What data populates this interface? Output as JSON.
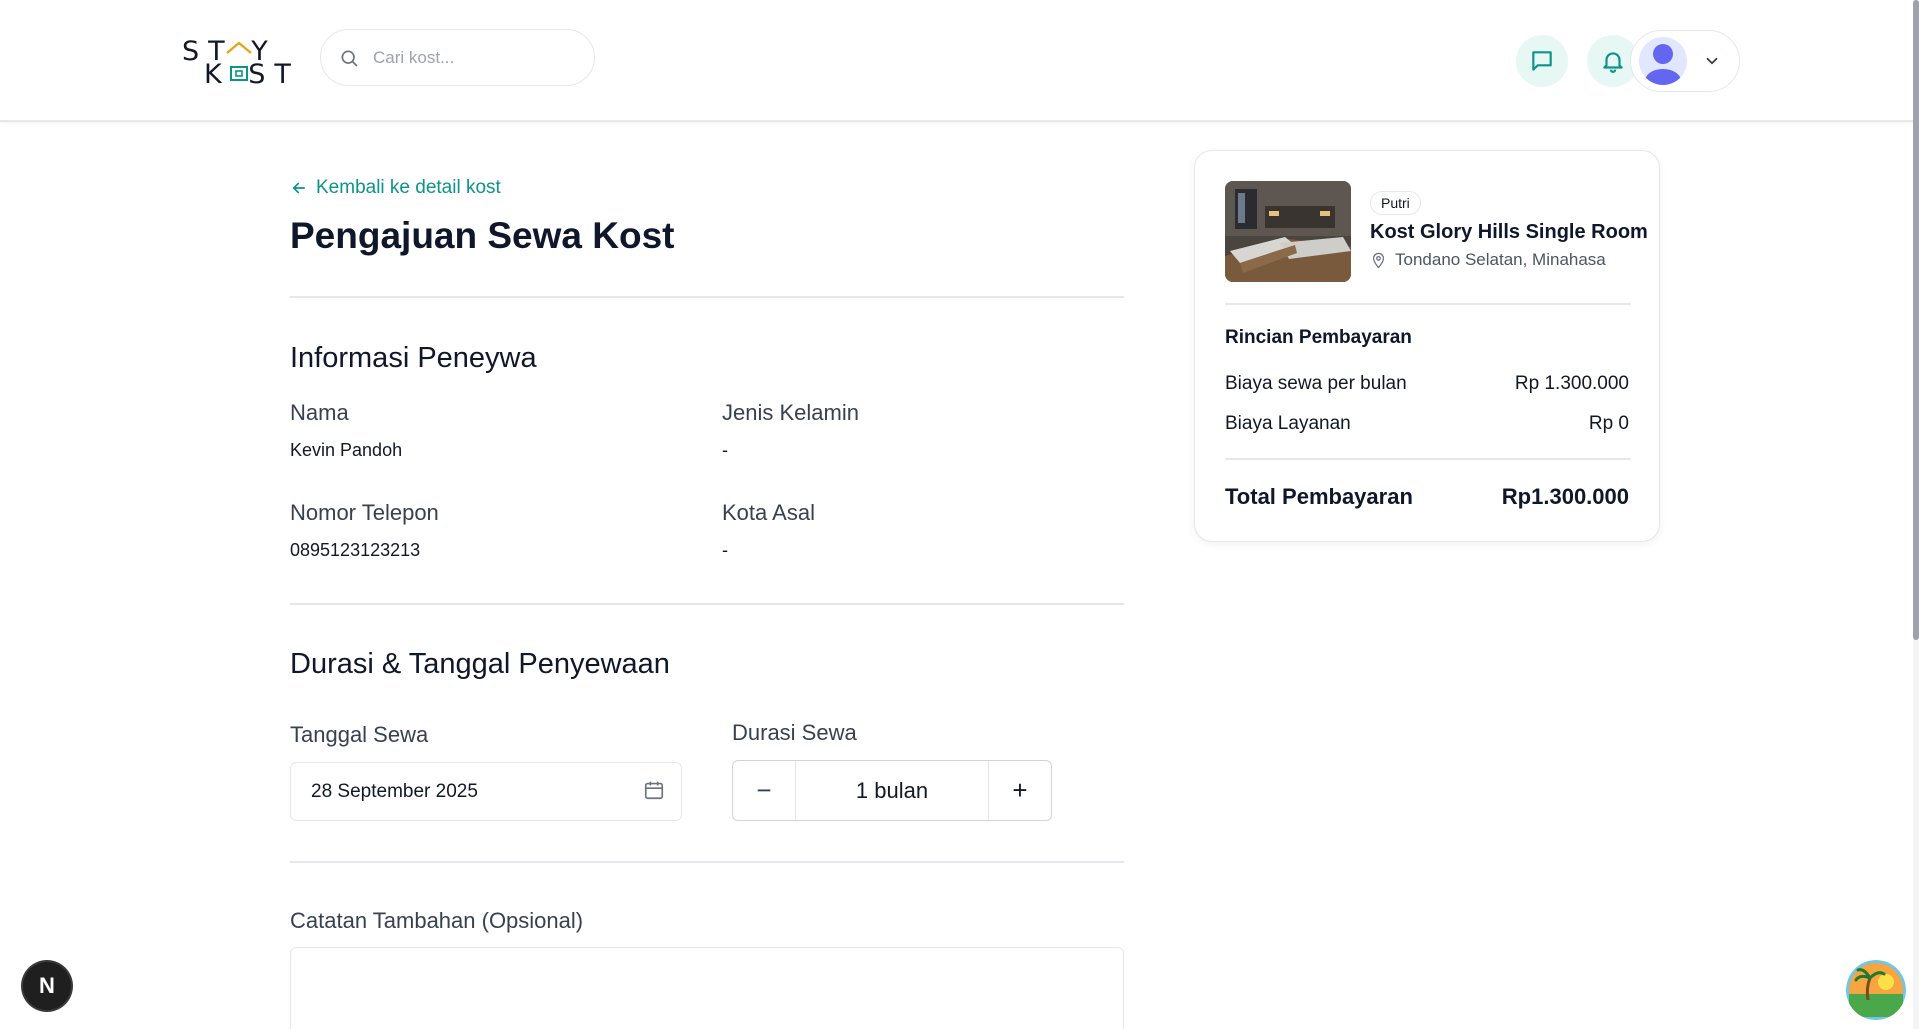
{
  "header": {
    "logo_line1": "ST  Y",
    "logo_line2": "K  ST",
    "search_placeholder": "Cari kost...",
    "icons": [
      "chat-icon",
      "bell-icon",
      "avatar",
      "chevron-down-icon"
    ]
  },
  "main": {
    "back_link": "Kembali ke detail kost",
    "title": "Pengajuan Sewa Kost",
    "tenant_section": {
      "title": "Informasi Peneywa",
      "fields": [
        {
          "label": "Nama",
          "value": "Kevin Pandoh"
        },
        {
          "label": "Jenis Kelamin",
          "value": "-"
        },
        {
          "label": "Nomor Telepon",
          "value": "0895123123213"
        },
        {
          "label": "Kota Asal",
          "value": "-"
        }
      ]
    },
    "rental_section": {
      "title": "Durasi & Tanggal Penyewaan",
      "date_label": "Tanggal Sewa",
      "date_value": "28 September 2025",
      "duration_label": "Durasi Sewa",
      "duration_value": "1 bulan",
      "minus": "−",
      "plus": "+"
    },
    "notes_label": "Catatan Tambahan (Opsional)"
  },
  "summary": {
    "badge": "Putri",
    "kost_name": "Kost Glory Hills Single Room",
    "location": "Tondano Selatan, Minahasa",
    "breakdown_title": "Rincian Pembayaran",
    "rows": [
      {
        "label": "Biaya sewa per bulan",
        "value": "Rp 1.300.000"
      },
      {
        "label": "Biaya Layanan",
        "value": "Rp 0"
      }
    ],
    "total_label": "Total Pembayaran",
    "total_value": "Rp1.300.000"
  },
  "floating": {
    "dev_badge": "N"
  },
  "colors": {
    "accent": "#0d9488",
    "icon_bg": "#e6f7f4"
  }
}
